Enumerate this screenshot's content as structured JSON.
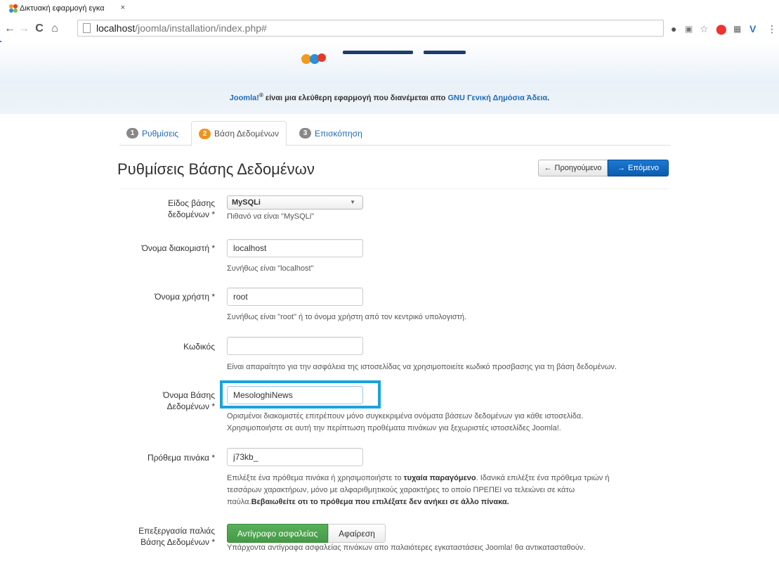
{
  "browser": {
    "tab_title": "Δικτυακή εφαρμογή εγκα",
    "tab_close": "×",
    "url_host": "localhost",
    "url_path": "/joomla/installation/index.php#"
  },
  "license": {
    "joomla": "Joomla!",
    "reg": "®",
    "text": " είναι μια ελεύθερη εφαρμογή που διανέμεται απο ",
    "link": "GNU Γενική Δημόσια Άδεια",
    "end": "."
  },
  "steps": [
    {
      "num": "1",
      "label": "Ρυθμίσεις"
    },
    {
      "num": "2",
      "label": "Βάση Δεδομένων"
    },
    {
      "num": "3",
      "label": "Επισκόπηση"
    }
  ],
  "heading": "Ρυθμίσεις Βάσης Δεδομένων",
  "buttons": {
    "previous": "Προηγούμενο",
    "next": "Επόμενο",
    "backup": "Αντίγραφο ασφαλείας",
    "remove": "Αφαίρεση"
  },
  "form": {
    "db_type": {
      "label_line1": "Είδος βάσης",
      "label_line2": "δεδομένων *",
      "value": "MySQLi",
      "help": "Πιθανό να είναι \"MySQLi\""
    },
    "host": {
      "label": "Όνομα διακομιστή *",
      "value": "localhost",
      "help": "Συνήθως είναι \"localhost\""
    },
    "user": {
      "label": "Όνομα χρήστη *",
      "value": "root",
      "help": "Συνήθως είναι \"root\" ή το όνομα χρήστη από τον κεντρικό υπολογιστή."
    },
    "password": {
      "label": "Κωδικός",
      "value": "",
      "help": "Είναι απαραίτητο για την ασφάλεια της ιστοσελίδας να χρησιμοποιείτε κωδικό προσβασης για τη βάση δεδομένων."
    },
    "db_name": {
      "label_line1": "Όνομα Βάσης",
      "label_line2": "Δεδομένων *",
      "value": "MesologhiNews",
      "help_line1": "Ορισμένοι διακομιστές επιτρέπουν μόνο συγκεκριμένα ονόματα βάσεων δεδομένων για κάθε ιστοσελίδα.",
      "help_line2": "Χρησιμοποιήστε σε αυτή την περίπτωση προθέματα πινάκων για ξεχωριστές ιστοσελίδες Joomla!."
    },
    "prefix": {
      "label": "Πρόθεμα πινάκα *",
      "value": "j73kb_",
      "help_a": "Επιλέξτε ένα πρόθεμα πινάκα ή χρησιμοποιήστε το ",
      "help_b": "τυχαία παραγόμενο",
      "help_c": ". Ιδανικά επιλέξτε ένα πρόθεμα τριών ή",
      "help_line2": "τεσσάρων χαρακτήρων, μόνο με αλφαριθμητικούς χαρακτήρες το οποίο ΠΡΕΠΕΙ να τελειώνει σε κάτω",
      "help_line3a": "παύλα.",
      "help_line3b": "Βεβαιωθείτε οτι το πρόθεμα που επιλέξατε δεν ανήκει σε άλλο πίνακα."
    },
    "old_db": {
      "label_line1": "Επεξεργασία παλιάς",
      "label_line2": "Βάσης Δεδομένων *",
      "help": "Υπάρχοντα αντίγραφα ασφαλείας πινάκων απο παλαιότερες εγκαταστάσεις Joomla! θα αντικατασταθούν."
    }
  },
  "colors": {
    "accent": "#1e6ab5",
    "highlight": "#1aa3dd",
    "success": "#459a46",
    "active_step": "#f0931e"
  }
}
